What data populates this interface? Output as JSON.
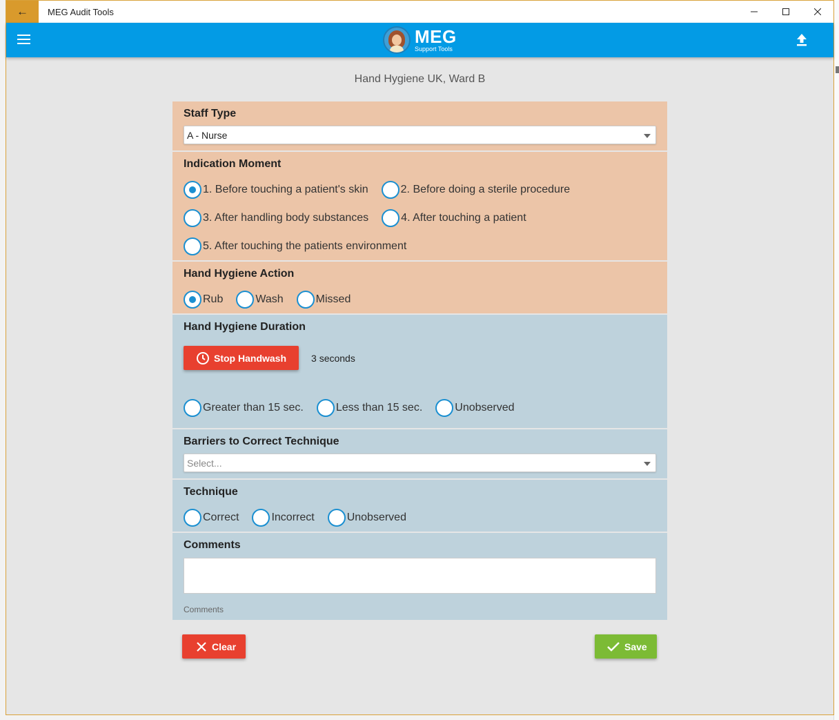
{
  "window": {
    "title": "MEG Audit Tools",
    "back_icon": "arrow-left-icon",
    "controls": [
      "minimize-icon",
      "maximize-icon",
      "close-icon"
    ]
  },
  "header": {
    "logo_main": "MEG",
    "logo_sub": "Support Tools",
    "menu_icon": "hamburger-icon",
    "upload_icon": "upload-icon"
  },
  "page": {
    "subtitle": "Hand Hygiene UK, Ward B"
  },
  "form": {
    "staff_type": {
      "title": "Staff Type",
      "selected": "A - Nurse"
    },
    "indication_moment": {
      "title": "Indication Moment",
      "options": [
        {
          "label": "1. Before touching a patient's skin",
          "checked": true
        },
        {
          "label": "2. Before doing a sterile procedure",
          "checked": false
        },
        {
          "label": "3. After handling body substances",
          "checked": false
        },
        {
          "label": "4. After touching a patient",
          "checked": false
        },
        {
          "label": "5. After touching the patients environment",
          "checked": false
        }
      ]
    },
    "hand_hygiene_action": {
      "title": "Hand Hygiene Action",
      "options": [
        {
          "label": "Rub",
          "checked": true
        },
        {
          "label": "Wash",
          "checked": false
        },
        {
          "label": "Missed",
          "checked": false
        }
      ]
    },
    "hand_hygiene_duration": {
      "title": "Hand Hygiene Duration",
      "button_label": "Stop Handwash",
      "timer": "3 seconds",
      "options": [
        {
          "label": "Greater than 15 sec.",
          "checked": false
        },
        {
          "label": "Less than 15 sec.",
          "checked": false
        },
        {
          "label": "Unobserved",
          "checked": false
        }
      ]
    },
    "barriers": {
      "title": "Barriers to Correct Technique",
      "placeholder": "Select..."
    },
    "technique": {
      "title": "Technique",
      "options": [
        {
          "label": "Correct",
          "checked": false
        },
        {
          "label": "Incorrect",
          "checked": false
        },
        {
          "label": "Unobserved",
          "checked": false
        }
      ]
    },
    "comments": {
      "title": "Comments",
      "value": "",
      "hint": "Comments"
    }
  },
  "actions": {
    "clear_label": "Clear",
    "save_label": "Save"
  },
  "colors": {
    "accent": "#039be5",
    "peach": "#ecc5a8",
    "blue_gray": "#bed2dc",
    "danger": "#e8402f",
    "success": "#7cbb35",
    "radio": "#1a8fd1"
  }
}
